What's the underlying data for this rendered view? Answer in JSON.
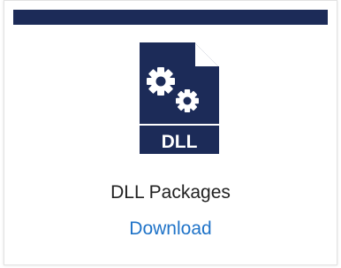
{
  "card": {
    "title": "DLL Packages",
    "link_label": "Download",
    "icon": "dll-file-icon",
    "icon_badge_text": "DLL",
    "colors": {
      "header_bar": "#1c2b58",
      "icon": "#1c2b58",
      "link": "#1f73c8",
      "title": "#222222"
    }
  }
}
